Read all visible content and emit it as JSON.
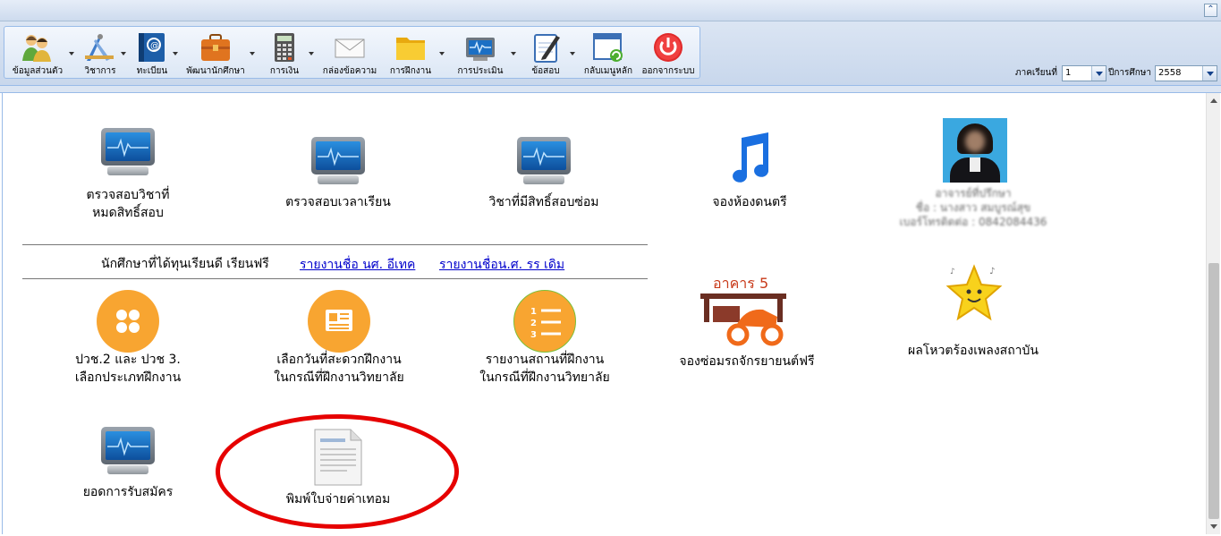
{
  "toolbar": {
    "items": [
      {
        "label": "ข้อมูลส่วนตัว",
        "icon": "users-icon"
      },
      {
        "label": "วิชาการ",
        "icon": "drafting-tools-icon"
      },
      {
        "label": "ทะเบียน",
        "icon": "address-book-icon"
      },
      {
        "label": "พัฒนานักศึกษา",
        "icon": "briefcase-icon"
      },
      {
        "label": "การเงิน",
        "icon": "calculator-icon"
      },
      {
        "label": "กล่องข้อความ",
        "icon": "envelope-icon"
      },
      {
        "label": "การฝึกงาน",
        "icon": "folder-icon"
      },
      {
        "label": "การประเมิน",
        "icon": "monitor-icon"
      },
      {
        "label": "ข้อสอบ",
        "icon": "notepad-icon"
      },
      {
        "label": "กลับเมนูหลัก",
        "icon": "window-refresh-icon"
      },
      {
        "label": "ออกจากระบบ",
        "icon": "power-icon"
      }
    ],
    "term_label": "ภาคเรียนที่",
    "term_value": "1",
    "year_label": "ปีการศึกษา",
    "year_value": "2558"
  },
  "tiles": {
    "t1": {
      "line1": "ตรวจสอบวิชาที่",
      "line2": "หมดสิทธิ์สอบ"
    },
    "t2": {
      "line1": "ตรวจสอบเวลาเรียน"
    },
    "t3": {
      "line1": "วิชาที่มีสิทธิ์สอบซ่อม"
    },
    "t4": {
      "line1": "จองห้องดนตรี"
    },
    "t5": {
      "line1": "ปวช.2 และ ปวช 3.",
      "line2": "เลือกประเภทฝึกงาน"
    },
    "t6": {
      "line1": "เลือกวันที่สะดวกฝึกงาน",
      "line2": "ในกรณีที่ฝึกงานวิทยาลัย"
    },
    "t7": {
      "line1": "รายงานสถานที่ฝึกงาน",
      "line2": "ในกรณีที่ฝึกงานวิทยาลัย"
    },
    "t8": {
      "line1": "จองซ่อมรถจักรยายนต์ฟรี",
      "building_label": "อาคาร 5"
    },
    "t9": {
      "line1": "ผลโหวตร้องเพลงสถาบัน"
    },
    "t10": {
      "line1": "ยอดการรับสมัคร"
    },
    "t11": {
      "line1": "พิมพ์ใบจ่ายค่าเทอม"
    }
  },
  "scholarship": {
    "label": "นักศึกษาที่ได้ทุนเรียนดี เรียนฟรี",
    "link1": "รายงานชื่อ นศ. อีเทค",
    "link2": "รายงานชื่อน.ศ. รร เดิม"
  },
  "advisor": {
    "title": "อาจารย์ที่ปรึกษา",
    "name": "ชื่อ : นางสาว สมบูรณ์สุข",
    "phone": "เบอร์โทรติดต่อ : 0842084436"
  },
  "colors": {
    "orange": "#f8a531",
    "highlight": "#e60000",
    "link": "#0000cc"
  }
}
